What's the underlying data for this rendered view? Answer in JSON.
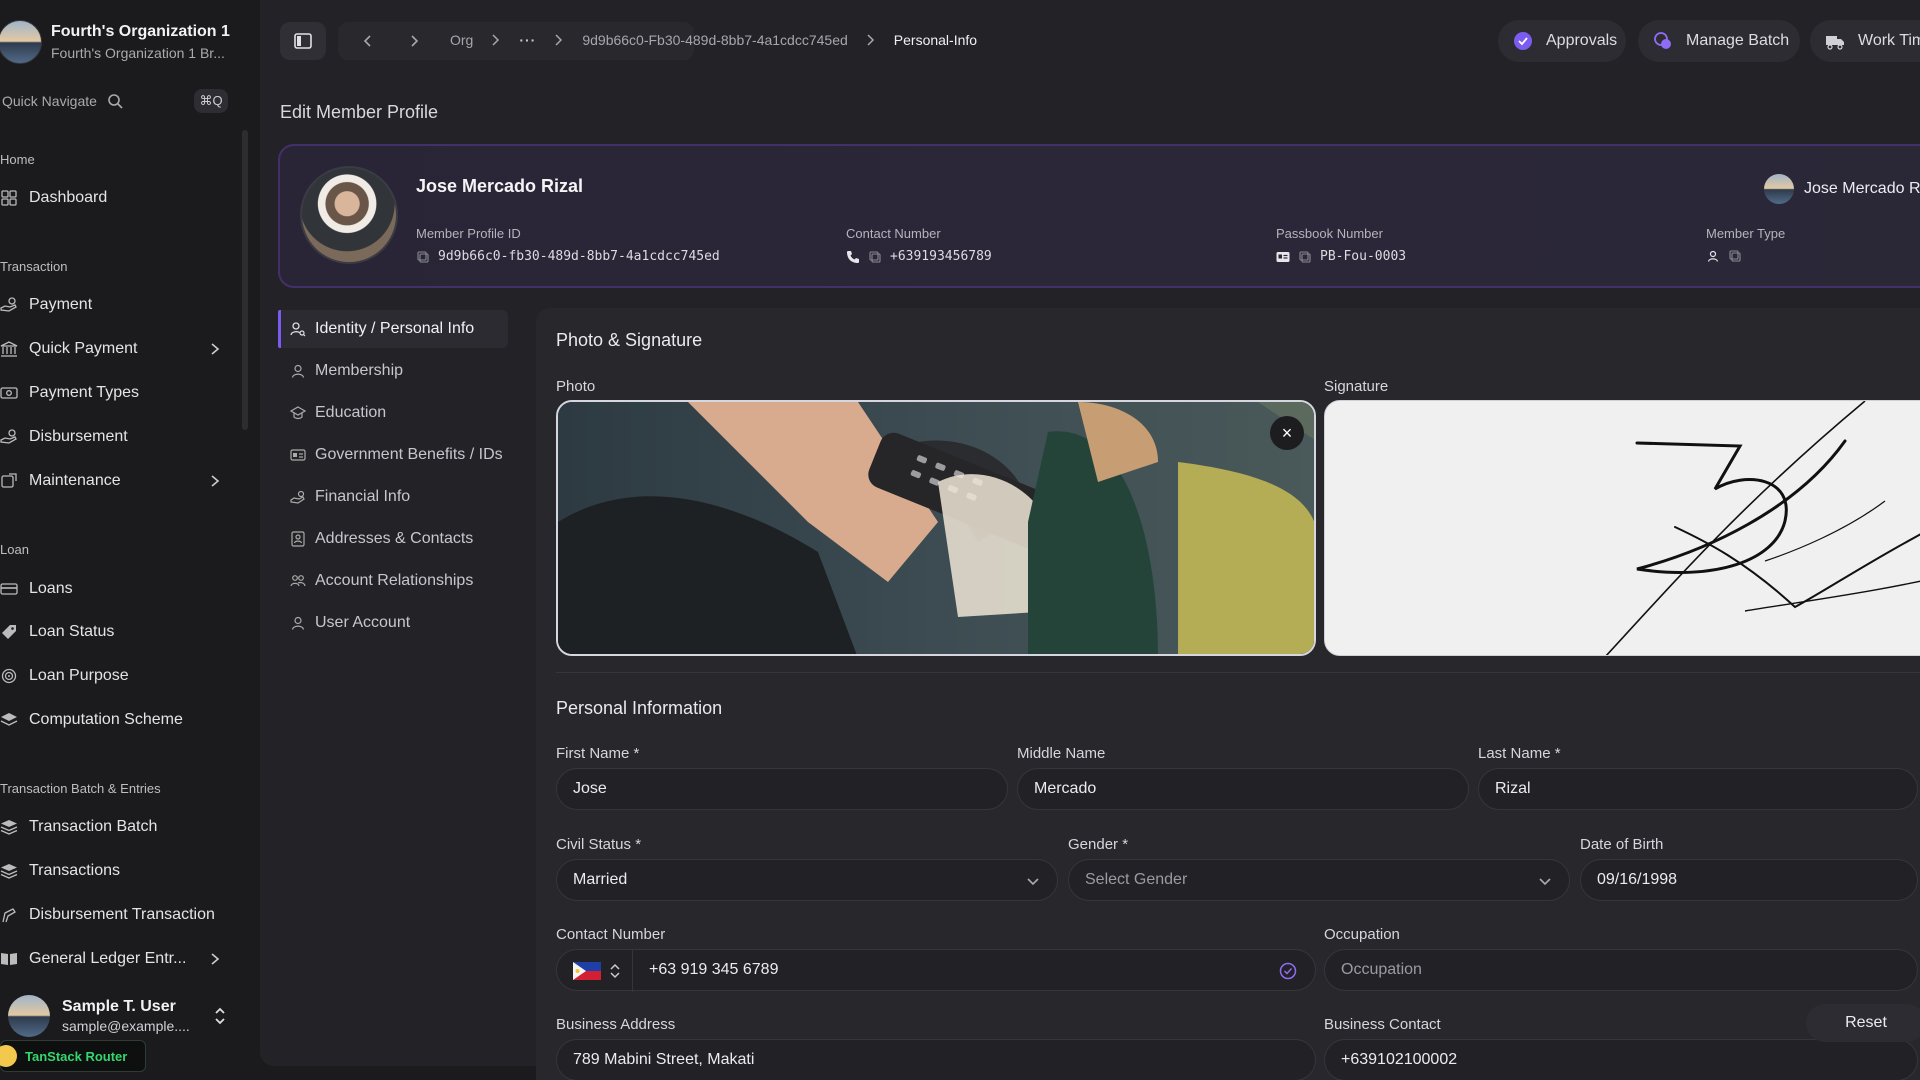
{
  "org": {
    "name": "Fourth's Organization 1",
    "subtitle": "Fourth's Organization 1 Br..."
  },
  "quick_nav": {
    "label": "Quick Navigate",
    "shortcut": "⌘Q"
  },
  "sidebar": {
    "sections": [
      {
        "title": "Home",
        "items": [
          {
            "label": "Dashboard",
            "icon": "dashboard-icon"
          }
        ]
      },
      {
        "title": "Transaction",
        "items": [
          {
            "label": "Payment",
            "icon": "hand-coins-icon"
          },
          {
            "label": "Quick Payment",
            "icon": "bank-icon",
            "has_children": true
          },
          {
            "label": "Payment Types",
            "icon": "banknote-icon"
          },
          {
            "label": "Disbursement",
            "icon": "hand-coins-icon"
          },
          {
            "label": "Maintenance",
            "icon": "wrench-icon",
            "has_children": true
          }
        ]
      },
      {
        "title": "Loan",
        "items": [
          {
            "label": "Loans",
            "icon": "card-icon"
          },
          {
            "label": "Loan Status",
            "icon": "tag-icon"
          },
          {
            "label": "Loan Purpose",
            "icon": "target-icon"
          },
          {
            "label": "Computation Scheme",
            "icon": "layers-icon"
          }
        ]
      },
      {
        "title": "Transaction Batch & Entries",
        "items": [
          {
            "label": "Transaction Batch",
            "icon": "stack-icon"
          },
          {
            "label": "Transactions",
            "icon": "stack-icon"
          },
          {
            "label": "Disbursement Transaction",
            "icon": "hand-icon"
          },
          {
            "label": "General Ledger Entr...",
            "icon": "book-icon",
            "has_children": true
          }
        ]
      }
    ]
  },
  "user": {
    "name": "Sample T. User",
    "email": "sample@example...."
  },
  "devtools": {
    "label": "TanStack Router"
  },
  "topbar": {
    "breadcrumbs": [
      "Org",
      "···",
      "9d9b66c0-Fb30-489d-8bb7-4a1cdcc745ed",
      "Personal-Info"
    ],
    "buttons": [
      {
        "label": "Approvals",
        "icon": "badge-check-icon"
      },
      {
        "label": "Manage Batch",
        "icon": "coins-icon"
      },
      {
        "label": "Work Time",
        "icon": "truck-icon"
      }
    ]
  },
  "page_title": "Edit Member Profile",
  "member": {
    "name": "Jose Mercado Rizal",
    "profile_id_label": "Member Profile ID",
    "profile_id": "9d9b66c0-fb30-489d-8bb7-4a1cdcc745ed",
    "contact_label": "Contact Number",
    "contact": "+639193456789",
    "passbook_label": "Passbook Number",
    "passbook": "PB-Fou-0003",
    "member_type_label": "Member Type",
    "member_type": "",
    "right_name": "Jose Mercado Rizal"
  },
  "tabs": [
    {
      "label": "Identity / Personal Info",
      "icon": "user-search-icon",
      "active": true
    },
    {
      "label": "Membership",
      "icon": "user-icon"
    },
    {
      "label": "Education",
      "icon": "graduation-cap-icon"
    },
    {
      "label": "Government Benefits / IDs",
      "icon": "id-card-icon"
    },
    {
      "label": "Financial Info",
      "icon": "hand-coins-icon"
    },
    {
      "label": "Addresses & Contacts",
      "icon": "contacts-icon"
    },
    {
      "label": "Account Relationships",
      "icon": "users-icon"
    },
    {
      "label": "User Account",
      "icon": "user-icon"
    }
  ],
  "photo_signature": {
    "title": "Photo & Signature",
    "photo_label": "Photo",
    "signature_label": "Signature"
  },
  "personal": {
    "title": "Personal Information",
    "first_name": {
      "label": "First Name *",
      "value": "Jose"
    },
    "middle_name": {
      "label": "Middle Name",
      "value": "Mercado"
    },
    "last_name": {
      "label": "Last Name *",
      "value": "Rizal"
    },
    "civil_status": {
      "label": "Civil Status *",
      "value": "Married"
    },
    "gender": {
      "label": "Gender *",
      "placeholder": "Select Gender"
    },
    "dob": {
      "label": "Date of Birth",
      "value": "09/16/1998"
    },
    "contact_number": {
      "label": "Contact Number",
      "value": "+63 919 345 6789"
    },
    "occupation": {
      "label": "Occupation",
      "placeholder": "Occupation"
    },
    "business_address": {
      "label": "Business Address",
      "value": "789 Mabini Street, Makati"
    },
    "business_contact": {
      "label": "Business Contact",
      "value": "+639102100002"
    }
  },
  "actions": {
    "reset": "Reset"
  },
  "colors": {
    "accent": "#7b5cf0",
    "background": "#1b1b1e",
    "panel": "#232327"
  }
}
